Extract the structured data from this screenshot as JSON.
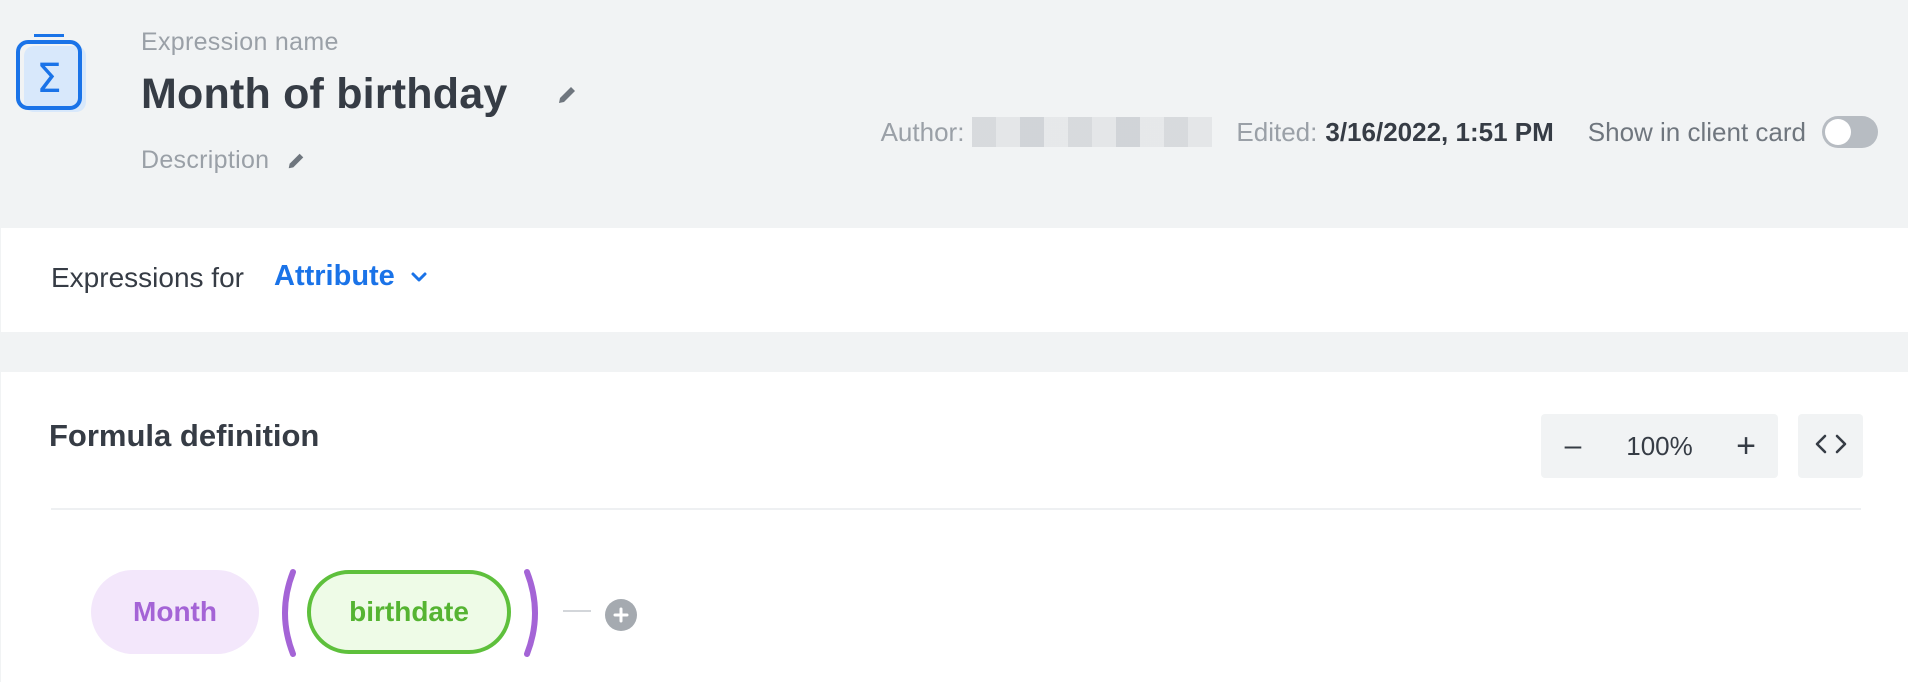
{
  "header": {
    "icon": "sigma-icon",
    "name_label": "Expression name",
    "title": "Month of birthday",
    "description_label": "Description",
    "author_label": "Author:",
    "edited_label": "Edited:",
    "edited_value": "3/16/2022, 1:51 PM",
    "show_in_client_card_label": "Show in client card",
    "show_in_client_card": false
  },
  "expressions": {
    "label": "Expressions for",
    "selected": "Attribute"
  },
  "formula": {
    "title": "Formula definition",
    "zoom_minus": "–",
    "zoom_value": "100%",
    "zoom_plus": "+",
    "code_toggle_icon": "code-icon",
    "function_name": "Month",
    "argument": "birthdate",
    "add_icon": "plus-circle-icon"
  },
  "colors": {
    "accent": "#1a73e8",
    "function_purple": "#a464d6",
    "argument_green": "#5ec03c"
  }
}
